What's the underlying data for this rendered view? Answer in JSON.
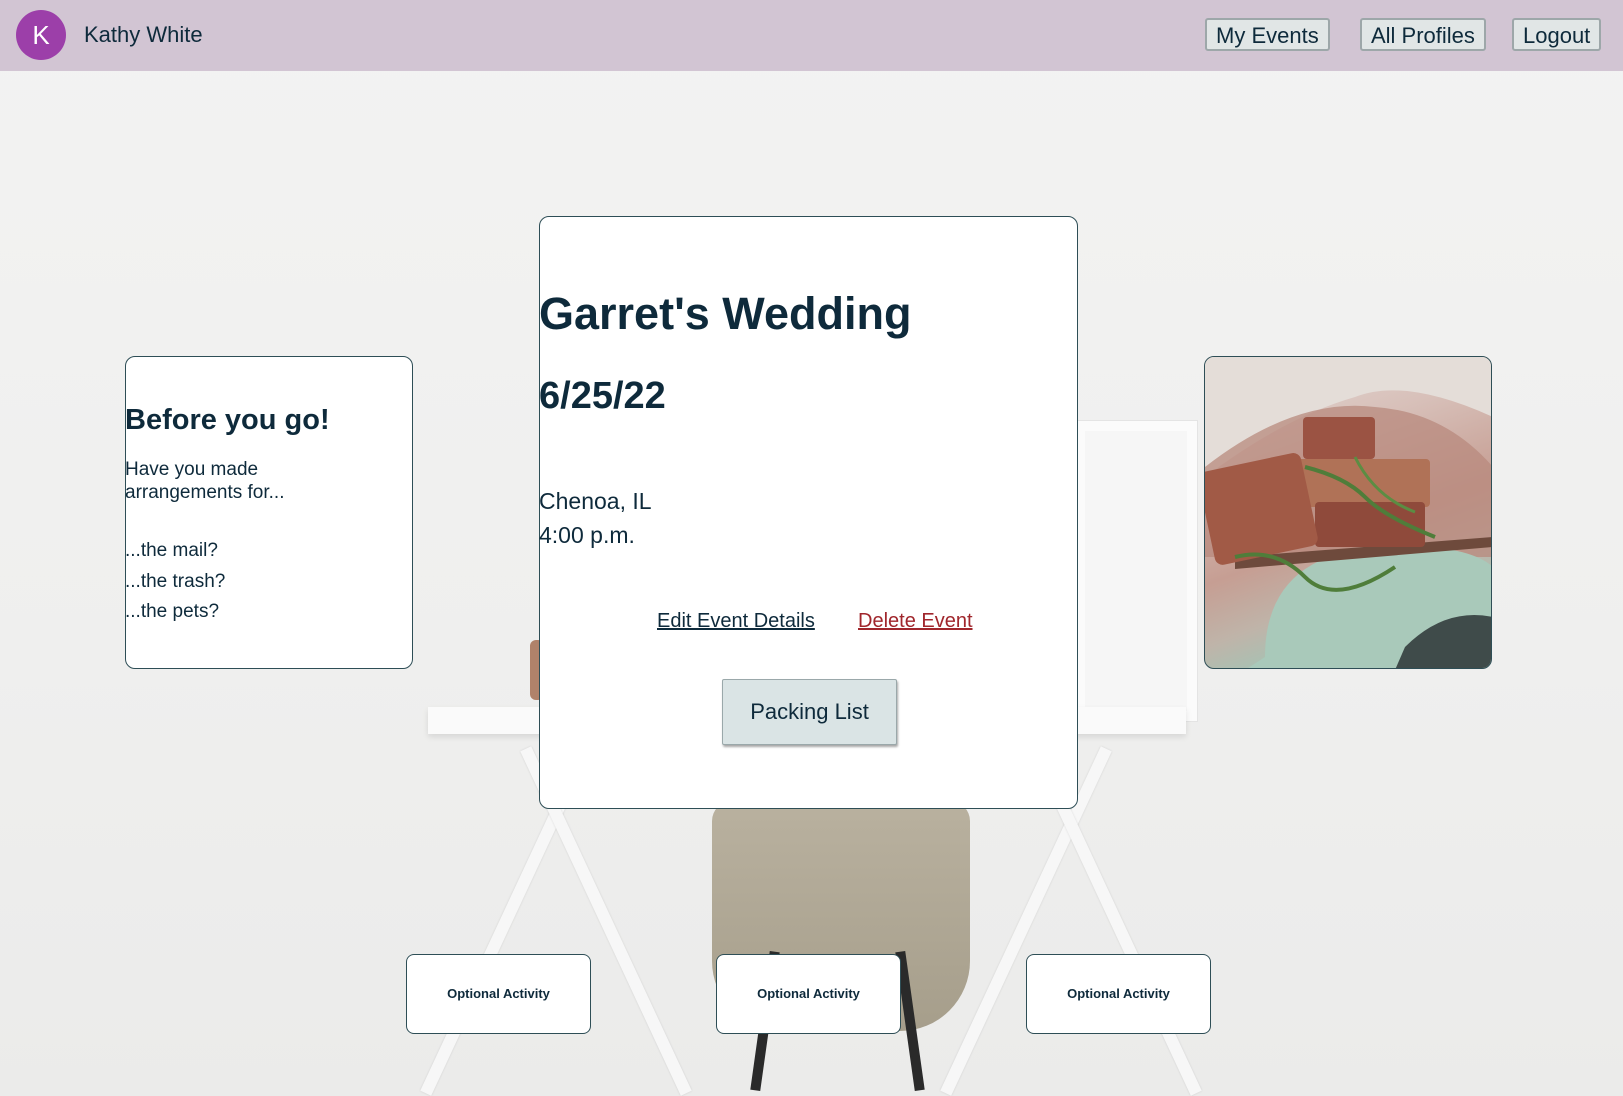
{
  "header": {
    "avatar_initial": "K",
    "user_name": "Kathy White",
    "nav": {
      "my_events": "My Events",
      "all_profiles": "All Profiles",
      "logout": "Logout"
    }
  },
  "event": {
    "title": "Garret's Wedding",
    "date": "6/25/22",
    "location": "Chenoa, IL",
    "time": "4:00 p.m.",
    "edit_label": "Edit Event Details",
    "delete_label": "Delete Event",
    "packing_list_label": "Packing List"
  },
  "reminder": {
    "title": "Before you go!",
    "line1": "Have you made",
    "line2": "arrangements for...",
    "items": [
      "...the mail?",
      "...the trash?",
      "...the pets?"
    ]
  },
  "activities": [
    "Optional Activity",
    "Optional Activity",
    "Optional Activity"
  ],
  "colors": {
    "header_bg": "#d2c5d3",
    "avatar": "#9c3fa9",
    "text": "#0e2a3b",
    "delete": "#a0262c",
    "button_bg": "#dae4e5"
  }
}
